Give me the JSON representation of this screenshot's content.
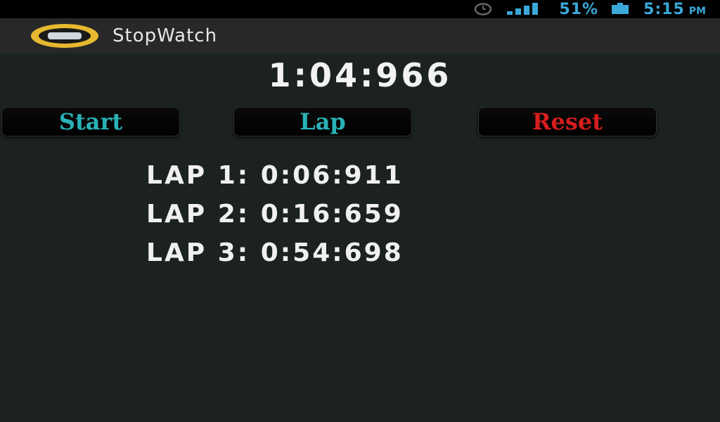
{
  "status_bar": {
    "battery_percent": "51%",
    "time": "5:15",
    "ampm": "PM",
    "signal_bars": 4,
    "icons": [
      "alarm-icon",
      "signal-icon",
      "battery-icon"
    ],
    "accent_color": "#3aa8d8"
  },
  "action_bar": {
    "title": "StopWatch",
    "icon": "stopwatch-app-icon"
  },
  "timer": {
    "display": "1:04:966"
  },
  "buttons": {
    "start_label": "Start",
    "lap_label": "Lap",
    "reset_label": "Reset",
    "start_color": "#29b2b6",
    "lap_color": "#29b2b6",
    "reset_color": "#d61d1d"
  },
  "laps": [
    "LAP 1: 0:06:911",
    "LAP 2: 0:16:659",
    "LAP 3: 0:54:698"
  ]
}
